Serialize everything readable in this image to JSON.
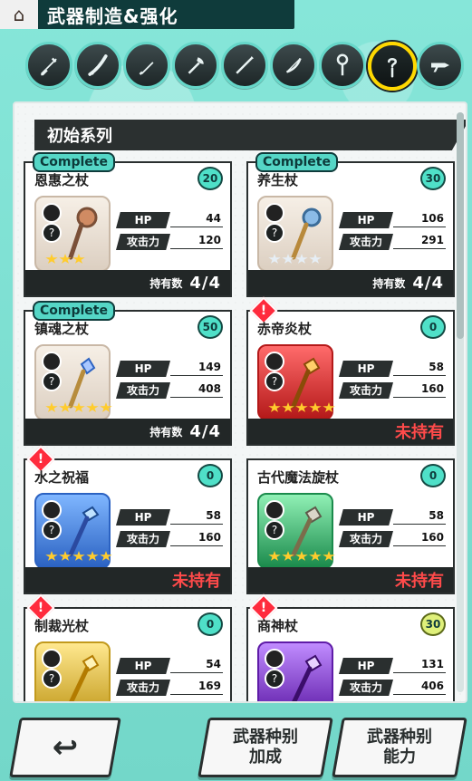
{
  "header": {
    "title": "武器制造&强化"
  },
  "tabs": [
    {
      "name": "sword",
      "icon": "sword-icon"
    },
    {
      "name": "katana",
      "icon": "katana-icon"
    },
    {
      "name": "dagger",
      "icon": "dagger-icon"
    },
    {
      "name": "axe",
      "icon": "axe-icon"
    },
    {
      "name": "spear",
      "icon": "spear-icon"
    },
    {
      "name": "bow",
      "icon": "bow-icon"
    },
    {
      "name": "staff",
      "icon": "staff-icon"
    },
    {
      "name": "rod",
      "icon": "question-rod-icon",
      "active": true
    },
    {
      "name": "gun",
      "icon": "gun-icon"
    }
  ],
  "section": {
    "title": "初始系列"
  },
  "weapons": [
    {
      "complete": "Complete",
      "name": "恩惠之杖",
      "level": "20",
      "stats": {
        "hp_label": "HP",
        "hp": "44",
        "atk_label": "攻击力",
        "atk": "120"
      },
      "own_label": "持有数",
      "own_value": "4/4",
      "missing": "",
      "art": "beige",
      "stars": "3",
      "star_type": "gold"
    },
    {
      "complete": "Complete",
      "name": "养生杖",
      "level": "30",
      "stats": {
        "hp_label": "HP",
        "hp": "106",
        "atk_label": "攻击力",
        "atk": "291"
      },
      "own_label": "持有数",
      "own_value": "4/4",
      "missing": "",
      "art": "beige",
      "stars": "4",
      "star_type": "silver"
    },
    {
      "complete": "Complete",
      "name": "镇魂之杖",
      "level": "50",
      "stats": {
        "hp_label": "HP",
        "hp": "149",
        "atk_label": "攻击力",
        "atk": "408"
      },
      "own_label": "持有数",
      "own_value": "4/4",
      "missing": "",
      "art": "beige",
      "stars": "5",
      "star_type": "gold"
    },
    {
      "complete": "",
      "name": "赤帝炎杖",
      "level": "0",
      "stats": {
        "hp_label": "HP",
        "hp": "58",
        "atk_label": "攻击力",
        "atk": "160"
      },
      "own_label": "",
      "own_value": "",
      "missing": "未持有",
      "art": "red",
      "stars": "5",
      "star_type": "gold"
    },
    {
      "complete": "",
      "name": "水之祝福",
      "level": "0",
      "stats": {
        "hp_label": "HP",
        "hp": "58",
        "atk_label": "攻击力",
        "atk": "160"
      },
      "own_label": "",
      "own_value": "",
      "missing": "未持有",
      "art": "blue",
      "stars": "5",
      "star_type": "gold"
    },
    {
      "complete": "",
      "name": "古代魔法旋杖",
      "level": "0",
      "stats": {
        "hp_label": "HP",
        "hp": "58",
        "atk_label": "攻击力",
        "atk": "160"
      },
      "own_label": "",
      "own_value": "",
      "missing": "未持有",
      "art": "green",
      "stars": "5",
      "star_type": "gold"
    },
    {
      "complete": "",
      "name": "制裁光杖",
      "level": "0",
      "stats": {
        "hp_label": "HP",
        "hp": "54",
        "atk_label": "攻击力",
        "atk": "169"
      },
      "own_label": "",
      "own_value": "",
      "missing": "",
      "art": "gold",
      "stars": "5",
      "star_type": "gold"
    },
    {
      "complete": "",
      "name": "商神杖",
      "level": "30",
      "stats": {
        "hp_label": "HP",
        "hp": "131",
        "atk_label": "攻击力",
        "atk": "406"
      },
      "own_label": "",
      "own_value": "",
      "missing": "",
      "art": "purple",
      "stars": "5",
      "star_type": "gold"
    }
  ],
  "footer": {
    "back_label": "↩",
    "b2_line1": "武器种别",
    "b2_line2": "加成",
    "b3_line1": "武器种别",
    "b3_line2": "能力"
  }
}
